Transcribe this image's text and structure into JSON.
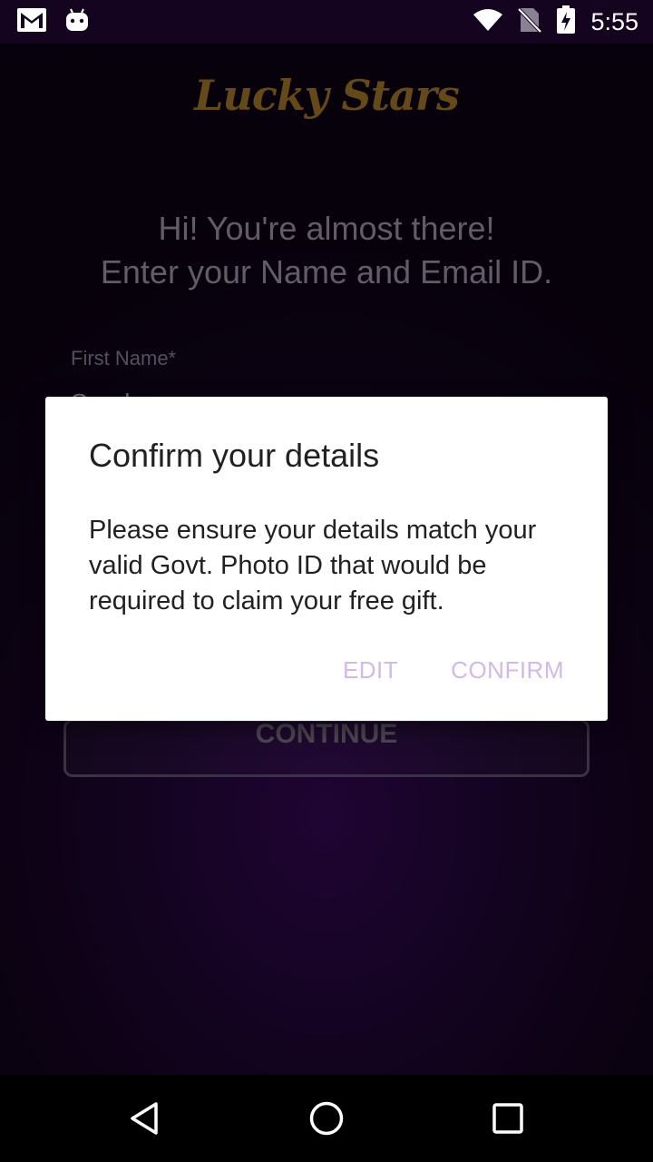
{
  "status_bar": {
    "time": "5:55",
    "icons_left": [
      "gmail-icon",
      "android-icon"
    ],
    "icons_right": [
      "wifi-icon",
      "no-sim-icon",
      "battery-charging-icon"
    ]
  },
  "app": {
    "logo_text": "Lucky Stars",
    "headline_line1": "Hi! You're almost there!",
    "headline_line2": "Enter your Name and Email ID.",
    "first_name_label": "First Name*",
    "first_name_value": "Sarah",
    "continue_label": "CONTINUE"
  },
  "dialog": {
    "title": "Confirm your details",
    "message": "Please ensure your details match your valid Govt. Photo ID that would be required to claim your free gift.",
    "edit_label": "EDIT",
    "confirm_label": "CONFIRM"
  },
  "nav": {
    "icons": [
      "back-icon",
      "home-icon",
      "recents-icon"
    ]
  },
  "colors": {
    "background": "#24073c",
    "logo": "#b8862d",
    "dialog_button": "#d3b8ea"
  }
}
